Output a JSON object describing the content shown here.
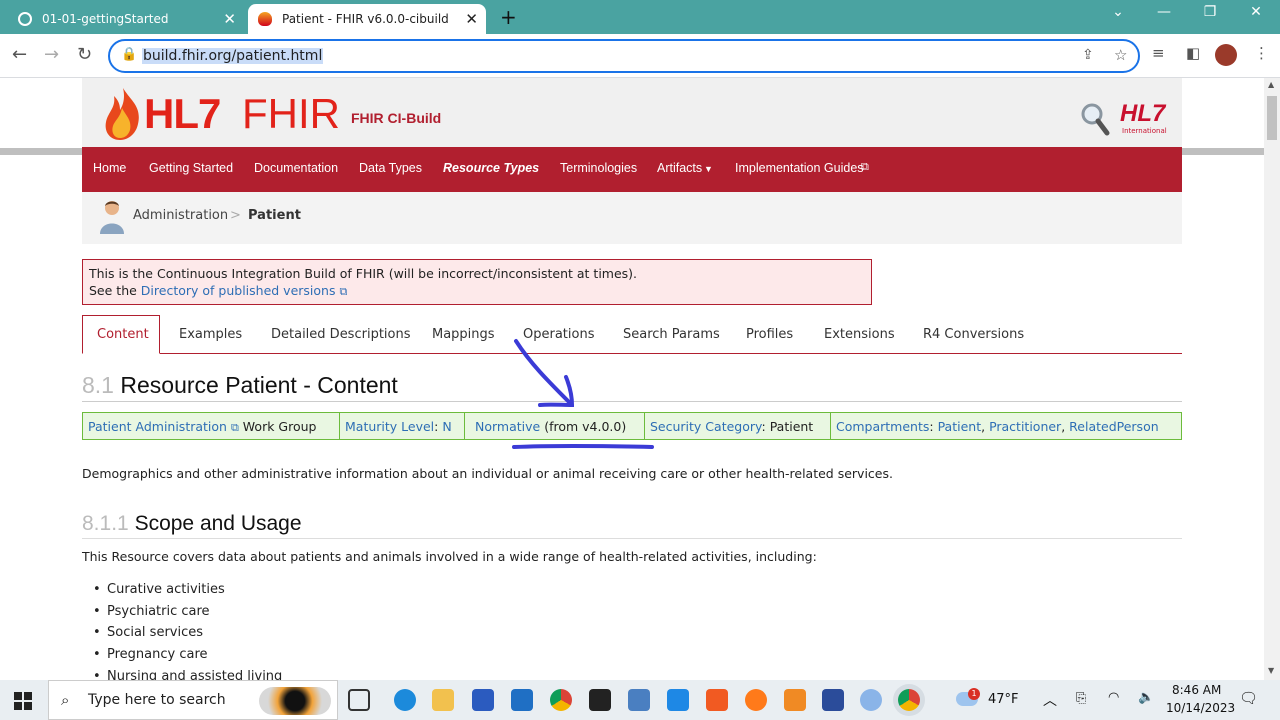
{
  "browser": {
    "tabs": [
      {
        "title": "01-01-gettingStarted",
        "active": false
      },
      {
        "title": "Patient - FHIR v6.0.0-cibuild",
        "active": true
      }
    ],
    "new_tab": "+",
    "url": "build.fhir.org/patient.html"
  },
  "site": {
    "logo_text_hl7": "HL7",
    "logo_text_fhir": "FHIR",
    "build_label": "FHIR CI-Build",
    "hl7_logo": "HL7",
    "hl7_logo_sub": "International",
    "menu": [
      "Home",
      "Getting Started",
      "Documentation",
      "Data Types",
      "Resource Types",
      "Terminologies",
      "Artifacts",
      "Implementation Guides"
    ],
    "breadcrumb": {
      "parent": "Administration",
      "sep": ">",
      "current": "Patient"
    },
    "notice": {
      "line1": "This is the Continuous Integration Build of FHIR (will be incorrect/inconsistent at times).",
      "line2_prefix": "See the",
      "line2_link": "Directory of published versions"
    },
    "page_tabs": [
      "Content",
      "Examples",
      "Detailed Descriptions",
      "Mappings",
      "Operations",
      "Search Params",
      "Profiles",
      "Extensions",
      "R4 Conversions"
    ]
  },
  "content": {
    "h1_num": "8.1",
    "h1_text": "Resource Patient - Content",
    "info": {
      "wg_link": "Patient Administration",
      "wg_suffix": "Work Group",
      "maturity_label": "Maturity Level",
      "maturity_value": "N",
      "normative_link": "Normative",
      "normative_suffix": "(from v4.0.0)",
      "security_label": "Security Category",
      "security_value": "Patient",
      "compartments_label": "Compartments",
      "compartments": [
        "Patient",
        "Practitioner",
        "RelatedPerson"
      ]
    },
    "description": "Demographics and other administrative information about an individual or animal receiving care or other health-related services.",
    "h2_num": "8.1.1",
    "h2_text": "Scope and Usage",
    "scope_intro": "This Resource covers data about patients and animals involved in a wide range of health-related activities, including:",
    "bullets": [
      "Curative activities",
      "Psychiatric care",
      "Social services",
      "Pregnancy care",
      "Nursing and assisted living"
    ]
  },
  "taskbar": {
    "search_placeholder": "Type here to search",
    "weather": "47°F",
    "weather_badge": "1",
    "time": "8:46 AM",
    "date": "10/14/2023"
  },
  "colors": {
    "fhir_red": "#b11f2f",
    "link": "#2e6eb5",
    "annotation": "#3b3bd6",
    "chrome_tab": "#4aa3a1"
  }
}
